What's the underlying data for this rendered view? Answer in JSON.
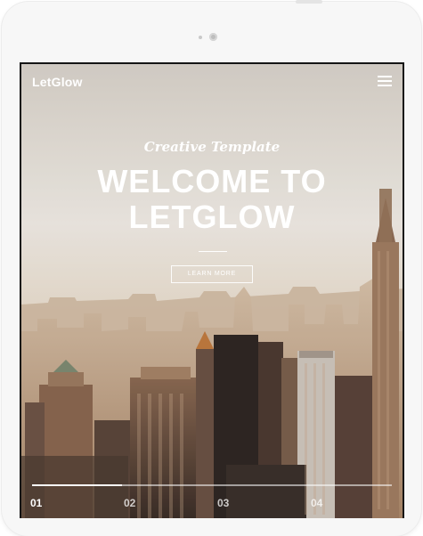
{
  "brand": {
    "logo_text": "LetGlow"
  },
  "header": {
    "menu_icon": "hamburger-menu-icon"
  },
  "hero": {
    "tagline": "Creative Template",
    "headline_line1": "WELCOME TO",
    "headline_line2": "LETGLOW",
    "cta_label": "LEARN MORE"
  },
  "slider": {
    "active_index": 0,
    "progress": 0.25,
    "slides": [
      {
        "label": "01"
      },
      {
        "label": "02"
      },
      {
        "label": "03"
      },
      {
        "label": "04"
      }
    ]
  },
  "colors": {
    "sky_top": "#f1ece4",
    "sky_horizon": "#e6d6c4",
    "city_warm": "#b99273",
    "city_dark": "#4a3a31",
    "text": "#ffffff"
  }
}
